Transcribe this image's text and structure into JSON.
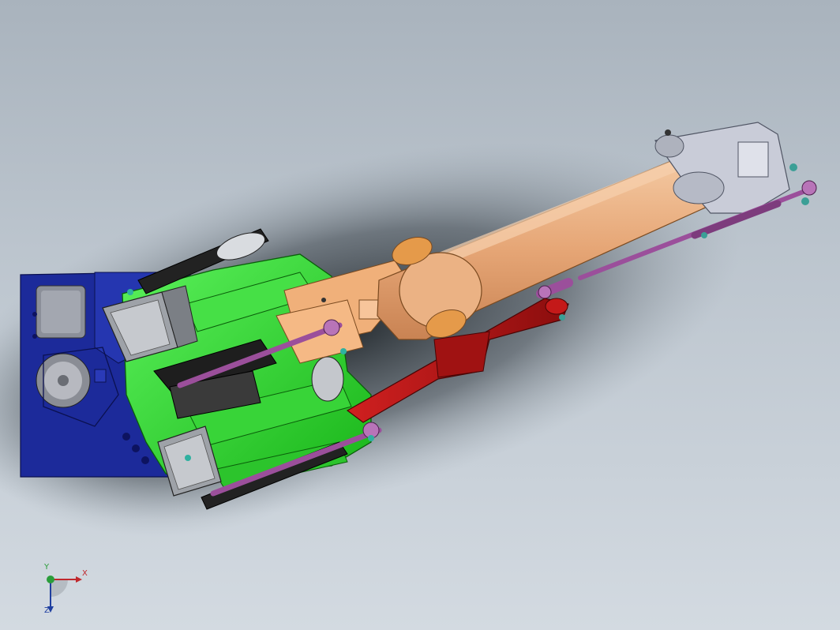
{
  "viewport": {
    "background_top": "#a9b3bd",
    "background_bottom": "#d3dae1"
  },
  "model": {
    "part_colors": {
      "base": "#1c2a9a",
      "motor_mount": "#2ee02e",
      "upper_arm": "#e8a877",
      "end_bracket": "#c9ccd8",
      "linkage_rods": "#9b4f9b",
      "lower_link": "#b01818",
      "belts": "#222222"
    }
  },
  "triad": {
    "x_label": "X",
    "y_label": "Y",
    "z_label": "Z",
    "x_color": "#c0282d",
    "y_color": "#2a9d3a",
    "z_color": "#1f3fa0"
  }
}
